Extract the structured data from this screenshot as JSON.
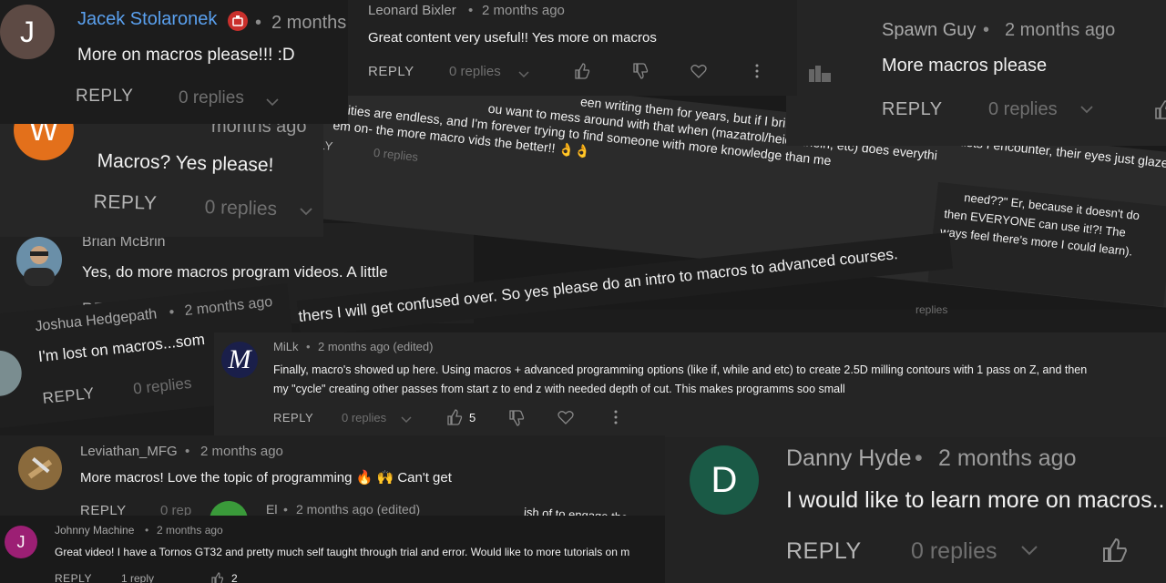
{
  "comments": {
    "jacek": {
      "name": "Jacek Stolaronek",
      "time": "2 months",
      "text": "More on macros please!!! :D",
      "reply": "REPLY",
      "replies": "0 replies",
      "avatar_letter": "J",
      "avatar_color": "#5d4a44"
    },
    "leonard": {
      "name": "Leonard Bixler",
      "time": "2 months ago",
      "text": "Great content very useful!! Yes more on macros",
      "reply": "REPLY",
      "replies": "0 replies"
    },
    "spawn": {
      "name": "Spawn Guy",
      "time": "2 months ago",
      "text": "More macros please",
      "reply": "REPLY",
      "replies": "0 replies"
    },
    "w": {
      "time": "months ago",
      "text": "Macros? Yes please!",
      "reply": "REPLY",
      "replies": "0 replies",
      "avatar_letter": "W",
      "avatar_color": "#e3701b"
    },
    "tilted": {
      "lines": [
        "ou want to mess around with that when (mazatrol/heidenhein, etc) does everythi",
        "ibilities are endless, and I'm forever trying to find someone with more knowledge than me",
        "'em on- the more macro vids the better!! 👌👌"
      ],
      "line_top": "een writing them for years, but if I bring up macros with most machinists I encounter, their eyes just glaze over and",
      "reply": "PLY",
      "replies": "0 replies"
    },
    "right_tilted": {
      "lines": [
        "need??\" Er, because it doesn't do",
        "then EVERYONE can use it!?! The",
        "ways feel there's more I could learn)."
      ],
      "replies": "replies"
    },
    "brian": {
      "name": "Brian McBrin",
      "text": "Yes, do more macros program videos. A little",
      "reply": "REPLY"
    },
    "confused": {
      "text": "thers I will get confused over.  So yes please do an intro to macros to advanced courses."
    },
    "joshua": {
      "name": "Joshua Hedgepath",
      "time": "2 months ago",
      "text": "I'm lost on macros...som",
      "reply": "REPLY",
      "replies": "0 replies"
    },
    "milk": {
      "name": "MiLk",
      "time": "2 months ago (edited)",
      "text1": "Finally, macro's showed up here. Using macros + advanced programming options (like if, while and etc) to create 2.5D milling contours with 1 pass on Z, and then",
      "text2": "my \"cycle\" creating other passes from start z to end z with needed depth of cut. This makes programms soo small",
      "reply": "REPLY",
      "replies": "0 replies",
      "likes": "5"
    },
    "leviathan": {
      "name": "Leviathan_MFG",
      "time": "2 months ago",
      "text": "More macros! Love the topic of programming 🔥 🙌 Can't get",
      "reply": "REPLY",
      "replies": "0 rep"
    },
    "el": {
      "name": "El",
      "time": "2 months ago (edited)",
      "text": "ish of to engage the en"
    },
    "danny": {
      "name": "Danny Hyde",
      "time": "2 months ago",
      "text": "I would like to learn more on macros...",
      "reply": "REPLY",
      "replies": "0 replies",
      "avatar_letter": "D",
      "avatar_color": "#1a5a46"
    },
    "johnny": {
      "name": "Johnny Machine",
      "time": "2 months ago",
      "text": "Great video! I have a Tornos GT32 and pretty much self taught through trial and error. Would like to more tutorials on m",
      "reply": "REPLY",
      "replies": "1 reply",
      "likes": "2",
      "avatar_letter": "J",
      "avatar_color": "#9c1f74"
    }
  },
  "dot": "•"
}
